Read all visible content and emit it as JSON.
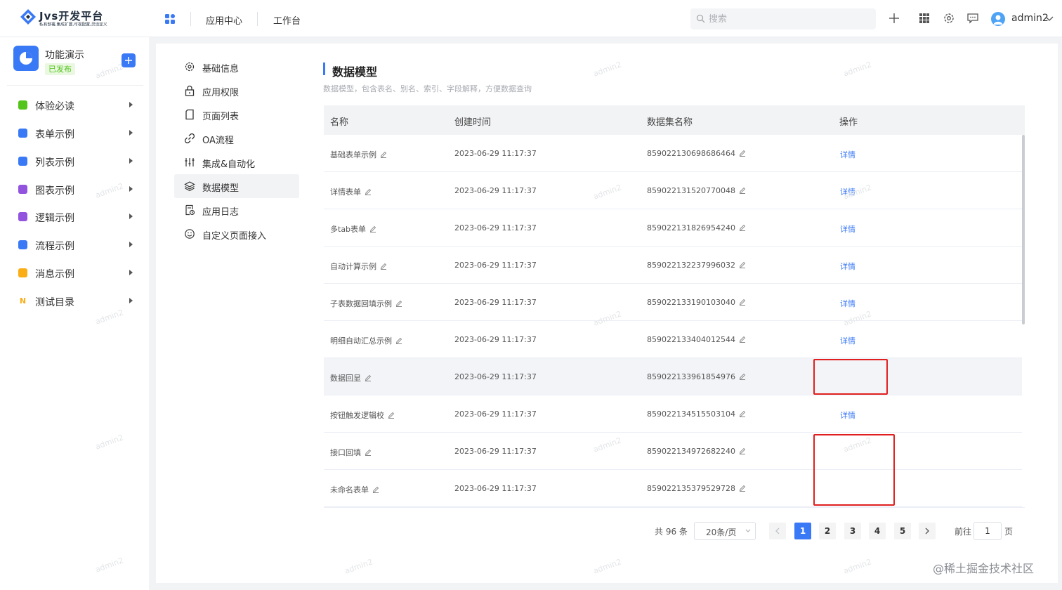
{
  "header": {
    "brand_title": "Jvs开发平台",
    "brand_subtitle": "私有部署,集成扩展,可视配置,灵活定义",
    "nav": [
      "应用中心",
      "工作台"
    ],
    "search_placeholder": "搜索",
    "username": "admin2"
  },
  "sidebar": {
    "app_name": "功能演示",
    "app_status": "已发布",
    "items": [
      {
        "label": "体验必读",
        "color": "#52c41a"
      },
      {
        "label": "表单示例",
        "color": "#3a79f6"
      },
      {
        "label": "列表示例",
        "color": "#3a79f6"
      },
      {
        "label": "图表示例",
        "color": "#9254de"
      },
      {
        "label": "逻辑示例",
        "color": "#9254de"
      },
      {
        "label": "流程示例",
        "color": "#3a79f6"
      },
      {
        "label": "消息示例",
        "color": "#faad14"
      },
      {
        "label": "测试目录",
        "color": "#faad14"
      }
    ]
  },
  "settings_menu": [
    {
      "label": "基础信息",
      "icon": "gear-icon"
    },
    {
      "label": "应用权限",
      "icon": "lock-icon"
    },
    {
      "label": "页面列表",
      "icon": "page-icon"
    },
    {
      "label": "OA流程",
      "icon": "link-icon"
    },
    {
      "label": "集成&自动化",
      "icon": "sliders-icon"
    },
    {
      "label": "数据模型",
      "icon": "layers-icon"
    },
    {
      "label": "应用日志",
      "icon": "log-icon"
    },
    {
      "label": "自定义页面接入",
      "icon": "smile-icon"
    }
  ],
  "main": {
    "title": "数据模型",
    "description": "数据模型，包含表名、别名、索引、字段解释，方便数据查询",
    "columns": [
      "名称",
      "创建时间",
      "数据集名称",
      "操作"
    ],
    "detail_label": "详情",
    "rows": [
      {
        "name": "基础表单示例",
        "created": "2023-06-29 11:17:37",
        "dataset": "859022130698686464",
        "action": "详情"
      },
      {
        "name": "详情表单",
        "created": "2023-06-29 11:17:37",
        "dataset": "859022131520770048",
        "action": "详情"
      },
      {
        "name": "多tab表单",
        "created": "2023-06-29 11:17:37",
        "dataset": "859022131826954240",
        "action": "详情"
      },
      {
        "name": "自动计算示例",
        "created": "2023-06-29 11:17:37",
        "dataset": "859022132237996032",
        "action": "详情"
      },
      {
        "name": "子表数据回填示例",
        "created": "2023-06-29 11:17:37",
        "dataset": "859022133190103040",
        "action": "详情"
      },
      {
        "name": "明细自动汇总示例",
        "created": "2023-06-29 11:17:37",
        "dataset": "859022133404012544",
        "action": "详情"
      },
      {
        "name": "数据回显",
        "created": "2023-06-29 11:17:37",
        "dataset": "859022133961854976",
        "action": ""
      },
      {
        "name": "按钮触发逻辑校",
        "created": "2023-06-29 11:17:37",
        "dataset": "859022134515503104",
        "action": "详情"
      },
      {
        "name": "接口回填",
        "created": "2023-06-29 11:17:37",
        "dataset": "859022134972682240",
        "action": ""
      },
      {
        "name": "未命名表单",
        "created": "2023-06-29 11:17:37",
        "dataset": "859022135379529728",
        "action": ""
      }
    ]
  },
  "pagination": {
    "total": "共 96 条",
    "page_size": "20条/页",
    "pages": [
      "1",
      "2",
      "3",
      "4",
      "5"
    ],
    "current": "1",
    "goto_label": "前往",
    "goto_value": "1",
    "page_suffix": "页"
  },
  "watermark_text": "admin2",
  "credit": "@稀土掘金技术社区",
  "colors": {
    "accent": "#3a79f6",
    "highlight_box": "#e02020",
    "published": "#52c41a"
  }
}
